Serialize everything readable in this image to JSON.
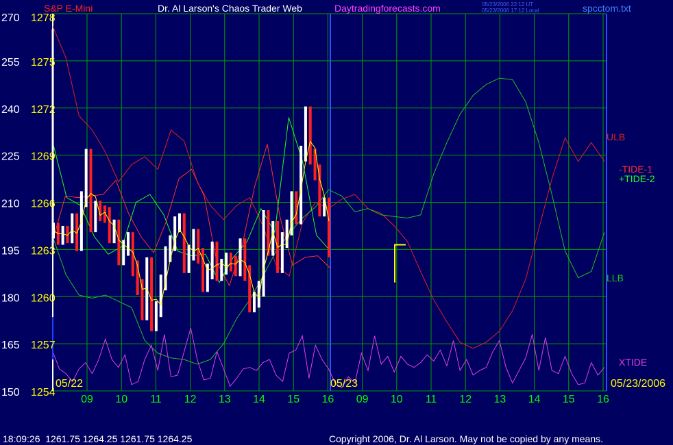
{
  "header": {
    "symbol": "S&P E-Mini",
    "title": "Dr. Al Larson's Chaos Trader Web",
    "site": "Daytradingforecasts.com",
    "stamp_ut": "05/23/2006 22:12 UT",
    "stamp_local": "05/23/2006 17:12 Local",
    "filename": "spcctom.txt"
  },
  "footer": {
    "status": "18:09:26  1261.75 1264.25 1261.75 1264.25",
    "copyright": "Copyright 2006, Dr. Al Larson. May not be copied by any means."
  },
  "colors": {
    "background": "#000060",
    "grid": "#00a000",
    "price_axis": "#ffff00",
    "index_axis": "#ffffff",
    "time_labels": "#00ff00",
    "title": "#ffffff",
    "symbol": "#ff2020",
    "site": "#ff40ff",
    "filename": "#4080ff",
    "ulb": "#dd2020",
    "llb": "#20c020",
    "tide1": "#ff3030",
    "tide2": "#20ff20",
    "xtide": "#e040e0",
    "price_up": "#ffffff",
    "price_down": "#ff2020",
    "average": "#ffff00",
    "blue_line": "#2040ff"
  },
  "chart_data": {
    "type": "line",
    "left_axis_values": [
      270,
      255,
      240,
      225,
      210,
      195,
      180,
      165,
      150
    ],
    "price_axis_values": [
      1278,
      1275,
      1272,
      1269,
      1266,
      1263,
      1260,
      1257,
      1254
    ],
    "ylim": [
      1254,
      1278
    ],
    "date_labels": [
      "05/22",
      "05/23",
      "05/23/2006"
    ],
    "x_tick_labels": [
      "09",
      "10",
      "11",
      "12",
      "13",
      "14",
      "15",
      "16",
      "09",
      "10",
      "11",
      "12",
      "13",
      "14",
      "15",
      "16"
    ],
    "grid": true,
    "series_labels": {
      "ulb": "ULB",
      "tide1": "-TIDE-1",
      "tide2": "+TIDE-2",
      "llb": "LLB",
      "xtide": "XTIDE"
    },
    "series": [
      {
        "name": "ULB",
        "values": [
          1277.2,
          1275.2,
          1271.5,
          1270.6,
          1269.2,
          1267.3,
          1268.4,
          1268.9,
          1268.1,
          1270.6,
          1269.9,
          1267.3,
          1265.8,
          1264.9,
          1265.8,
          1266.3,
          1264.5,
          1262.0,
          1261.3,
          1264.7,
          1266.0,
          1265.6,
          1266.2,
          1266.5,
          1265.6,
          1265.3,
          1264.5,
          1263.5,
          1261.6,
          1259.8,
          1258.4,
          1257.1,
          1256.7,
          1257.1,
          1257.8,
          1259.1,
          1261.1,
          1264.3,
          1267.5,
          1270.1,
          1268.6,
          1269.8,
          1268.6
        ]
      },
      {
        "name": "LLB",
        "values": [
          1263.8,
          1261.4,
          1260.1,
          1259.9,
          1260.1,
          1259.7,
          1259.3,
          1257.2,
          1256.4,
          1256.1,
          1256.0,
          1255.7,
          1256.0,
          1257.0,
          1258.6,
          1259.8,
          1261.3,
          1262.9,
          1264.0,
          1265.0,
          1265.7,
          1266.8,
          1266.4,
          1265.4,
          1265.6,
          1265.2,
          1265.1,
          1265.0,
          1265.2,
          1267.8,
          1269.8,
          1271.6,
          1272.8,
          1273.5,
          1273.9,
          1273.8,
          1272.4,
          1269.8,
          1266.5,
          1262.9,
          1261.2,
          1261.6,
          1264.1
        ]
      },
      {
        "name": "-TIDE-1",
        "values": [
          1263.6,
          1266.4,
          1266.3,
          1266.4,
          1266.5,
          1267.4,
          1265.3,
          1263.8,
          1262.8,
          1264.8,
          1267.5,
          1268.1,
          1266.4,
          1262.2,
          1260.7,
          1263.2,
          1267.0,
          1269.7,
          1265.1,
          1262.0,
          1262.5,
          1262.6,
          1261.8
        ]
      },
      {
        "name": "+TIDE-2",
        "values": [
          1269.8,
          1266.3,
          1265.8,
          1263.8,
          1262.7,
          1263.2,
          1266.0,
          1266.5,
          1265.2,
          1262.9,
          1262.6,
          1262.7,
          1260.9,
          1262.5,
          1263.5,
          1265.6,
          1264.1,
          1271.4,
          1268.6,
          1263.9,
          1262.9
        ]
      },
      {
        "name": "XTIDE",
        "values": [
          1256.5,
          1255.4,
          1255.1,
          1254.6,
          1255.4,
          1255.8,
          1255.1,
          1256.0,
          1257.3,
          1256.0,
          1255.5,
          1256.3,
          1254.4,
          1254.6,
          1256.0,
          1256.9,
          1255.3,
          1257.6,
          1254.9,
          1255.0,
          1256.5,
          1258.0,
          1256.0,
          1254.7,
          1254.8,
          1256.5,
          1255.4,
          1254.3,
          1254.8,
          1255.4,
          1255.5,
          1255.3,
          1255.8,
          1256.0,
          1255.0,
          1254.6,
          1256.4,
          1256.6,
          1257.5,
          1254.8,
          1256.9,
          1256.0,
          1255.4,
          1254.5,
          1254.2,
          1254.9,
          1254.5,
          1256.4,
          1255.3,
          1257.5,
          1255.7,
          1256.2,
          1255.2,
          1256.2,
          1255.7,
          1255.5,
          1255.8,
          1256.3,
          1255.9,
          1256.6,
          1255.6,
          1257.2,
          1255.3,
          1256.0,
          1255.0,
          1255.3,
          1255.5,
          1256.5,
          1257.2,
          1255.5,
          1254.5,
          1255.3,
          1256.1,
          1257.6,
          1255.3,
          1257.4,
          1255.3,
          1255.1,
          1256.2,
          1255.1,
          1254.4,
          1254.5,
          1255.8,
          1255.0,
          1255.5
        ]
      },
      {
        "name": "S&P E-Mini",
        "values": [
          1264.2,
          1263.8,
          1264.0,
          1263.9,
          1264.8,
          1263.4,
          1266.2,
          1268.9,
          1264.6,
          1265.6,
          1265.3,
          1265.2,
          1263.9,
          1264.4,
          1262.5,
          1263.1,
          1263.6,
          1261.8,
          1260.6,
          1259.0,
          1262.0,
          1258.3,
          1259.2,
          1260.9,
          1262.7,
          1263.4,
          1264.6,
          1264.8,
          1262.0,
          1262.8,
          1263.8,
          1262.6,
          1260.8,
          1261.6,
          1263.0,
          1261.5,
          1261.9,
          1262.3,
          1262.1,
          1261.8,
          1263.2,
          1261.5,
          1259.5,
          1259.8,
          1260.5,
          1265.0,
          1263.1,
          1264.3,
          1262.0,
          1263.6,
          1264.4,
          1266.2,
          1265.1,
          1269.1,
          1271.6,
          1268.9,
          1267.9,
          1265.6,
          1265.8,
          1263.0
        ]
      }
    ],
    "price_span": [
      1258.7,
      1256.0
    ],
    "market_bracket": [
      1263.3,
      1260.9
    ]
  }
}
